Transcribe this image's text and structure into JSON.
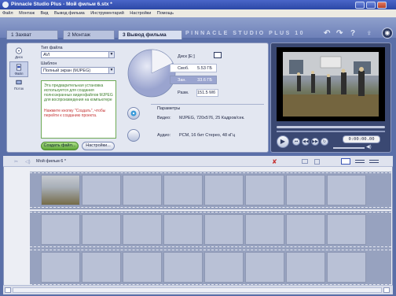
{
  "window": {
    "title": "Pinnacle Studio Plus - Мой фильм 6.stx *"
  },
  "menu": [
    "Файл",
    "Монтаж",
    "Вид",
    "Вывод фильма",
    "Инструментарий",
    "Настройки",
    "Помощь"
  ],
  "tabs": [
    {
      "num": "1",
      "label": "Захват"
    },
    {
      "num": "2",
      "label": "Монтаж"
    },
    {
      "num": "3",
      "label": "Вывод фильма"
    }
  ],
  "brand": "PINNACLE STUDIO PLUS 10",
  "sidebar": [
    {
      "label": "Диск"
    },
    {
      "label": "Файл"
    },
    {
      "label": "Поток"
    }
  ],
  "export": {
    "type_label": "Тип файла",
    "type_value": "AVI",
    "preset_label": "Шаблон",
    "preset_value": "Полный экран (MJPEG)",
    "desc_main": "Эта предварительная установка используется для создания полноэкранных видеофайлов MJPEG для воспроизведения на компьютере",
    "desc_hint": "Нажмите кнопку \"Создать\", чтобы перейти к созданию проекта.",
    "create_label": "Создать файл...",
    "settings_label": "Настройки..."
  },
  "disk": {
    "drive": "Диск [E:]",
    "free_label": "Своб.",
    "free_value": "5.53 ГБ",
    "used_label": "Зан.",
    "used_value": "33.6 ГБ",
    "size_label": "Разм.",
    "size_value": "151.5 Мб"
  },
  "params": {
    "title": "Параметры",
    "video_label": "Видео:",
    "video_value": "MJPEG, 720x576, 25 Кадров/сек.",
    "audio_label": "Аудио:",
    "audio_value": "PCM, 16 бит Стерео, 48 кГц"
  },
  "preview": {
    "timecode": "0:00:00.00"
  },
  "timeline": {
    "title": "Мой фильм 6 *"
  },
  "colors": {
    "accent": "#4a66c8",
    "panel": "#e3e7f1",
    "green": "#5fa638"
  }
}
